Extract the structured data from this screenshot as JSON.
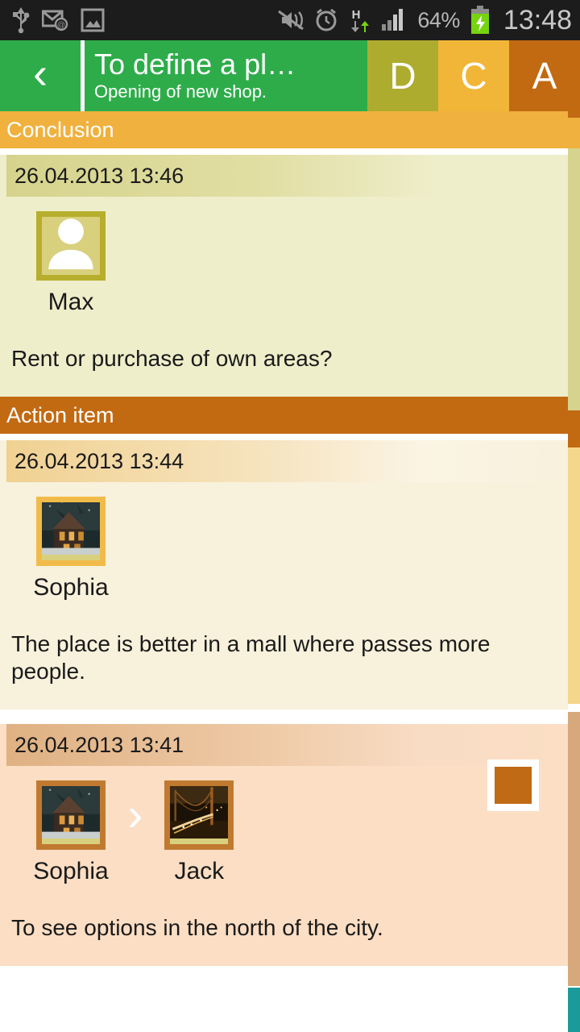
{
  "statusbar": {
    "icons": [
      "usb-icon",
      "email-at-icon",
      "gallery-image-icon",
      "vibrate-mute-icon",
      "alarm-clock-icon",
      "hspa-data-icon",
      "signal-bars-icon"
    ],
    "hspa_label": "H",
    "battery_percent": "64%",
    "battery_state": "charging",
    "clock": "13:48"
  },
  "header": {
    "back_icon": "‹",
    "title": "To define a pl…",
    "subtitle": "Opening of new shop.",
    "tabs": [
      {
        "label": "D",
        "color": "#aeac2f"
      },
      {
        "label": "C",
        "color": "#f1b638"
      },
      {
        "label": "A",
        "color": "#c26a12"
      }
    ]
  },
  "sections": [
    {
      "title": "Conclusion",
      "header_color": "#f0b13e",
      "cards": [
        {
          "date": "26.04.2013 13:46",
          "people": [
            {
              "name": "Max",
              "avatar": "default-person-avatar"
            }
          ],
          "separator": "",
          "chip": null,
          "text": "Rent or purchase of own areas?"
        }
      ]
    },
    {
      "title": "Action item",
      "header_color": "#c26a12",
      "cards": [
        {
          "date": "26.04.2013 13:44",
          "people": [
            {
              "name": "Sophia",
              "avatar": "victorian-house-night-photo"
            }
          ],
          "separator": "",
          "chip": null,
          "text": "The place is better in a mall where passes more people."
        },
        {
          "date": "26.04.2013 13:41",
          "people": [
            {
              "name": "Sophia",
              "avatar": "victorian-house-night-photo"
            },
            {
              "name": "Jack",
              "avatar": "suspension-bridge-night-photo"
            }
          ],
          "separator": "›",
          "chip": {
            "color": "#c06a16"
          },
          "text": "To see options in the north of the city."
        }
      ]
    }
  ],
  "scrollbar": {
    "thumb_color": "#1b9a9a"
  }
}
